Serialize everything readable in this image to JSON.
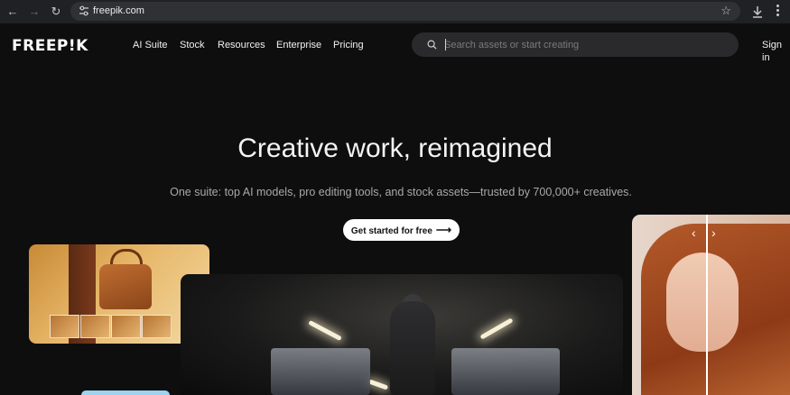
{
  "browser": {
    "url": "freepik.com",
    "icons": [
      "back-icon",
      "forward-icon",
      "reload-icon",
      "tune-icon",
      "star-icon",
      "download-icon",
      "more-icon"
    ]
  },
  "header": {
    "logo": "FREEP!K",
    "nav": [
      "AI Suite",
      "Stock",
      "Resources",
      "Enterprise",
      "Pricing"
    ],
    "search_placeholder": "Search assets or start creating",
    "signin": "Sign in"
  },
  "hero": {
    "title": "Creative work, reimagined",
    "subtitle": "One suite: top AI models, pro editing tools, and stock assets—trusted by 700,000+ creatives.",
    "cta": "Get started for free"
  },
  "colors": {
    "background": "#0e0e0f",
    "chrome": "#202124",
    "cta_bg": "#ffffff",
    "search_bg": "#2a2a2c"
  }
}
